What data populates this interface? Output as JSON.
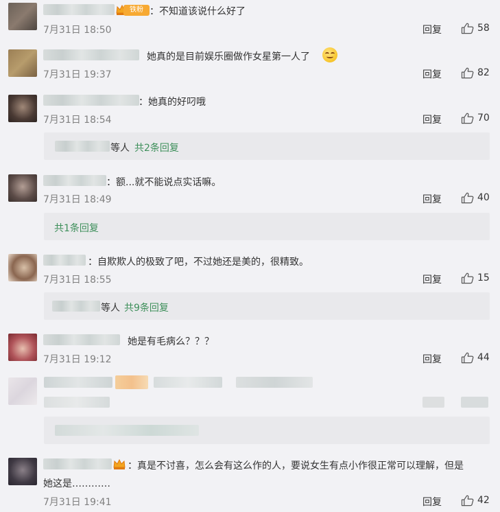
{
  "reply_label": "回复",
  "badge_label": "铁粉",
  "comments": [
    {
      "text": "：不知道该说什么好了",
      "time": "7月31日 18:50",
      "likes": "58"
    },
    {
      "text": "她真的是目前娱乐圈做作女星第一人了",
      "time": "7月31日 19:37",
      "likes": "82"
    },
    {
      "text": "：她真的好叼哦",
      "time": "7月31日 18:54",
      "likes": "70",
      "subreplies": {
        "people": "等人",
        "link": "共2条回复"
      }
    },
    {
      "text": "：额...就不能说点实话嘛。",
      "time": "7月31日 18:49",
      "likes": "40",
      "subreplies": {
        "link": "共1条回复"
      }
    },
    {
      "text": "：自欺欺人的极致了吧，不过她还是美的，很精致。",
      "time": "7月31日 18:55",
      "likes": "15",
      "subreplies": {
        "people": "等人",
        "link": "共9条回复"
      }
    },
    {
      "text": "她是有毛病么？？？",
      "time": "7月31日 19:12",
      "likes": "44"
    },
    {
      "text_line1": "：真是不讨喜，怎么会有这么作的人，要说女生有点小作很正常可以理解，但是",
      "text_line2": "她这是…………",
      "time": "7月31日 19:41",
      "likes": "42"
    }
  ],
  "icons": {
    "like": "thumbs-up-icon",
    "emoji": "smile-emoji-icon",
    "crown": "crown-icon"
  },
  "colors": {
    "background": "#f2f2f5",
    "link_green": "#3d8f5a",
    "time_gray": "#808080",
    "badge_orange": "#f7a932"
  }
}
